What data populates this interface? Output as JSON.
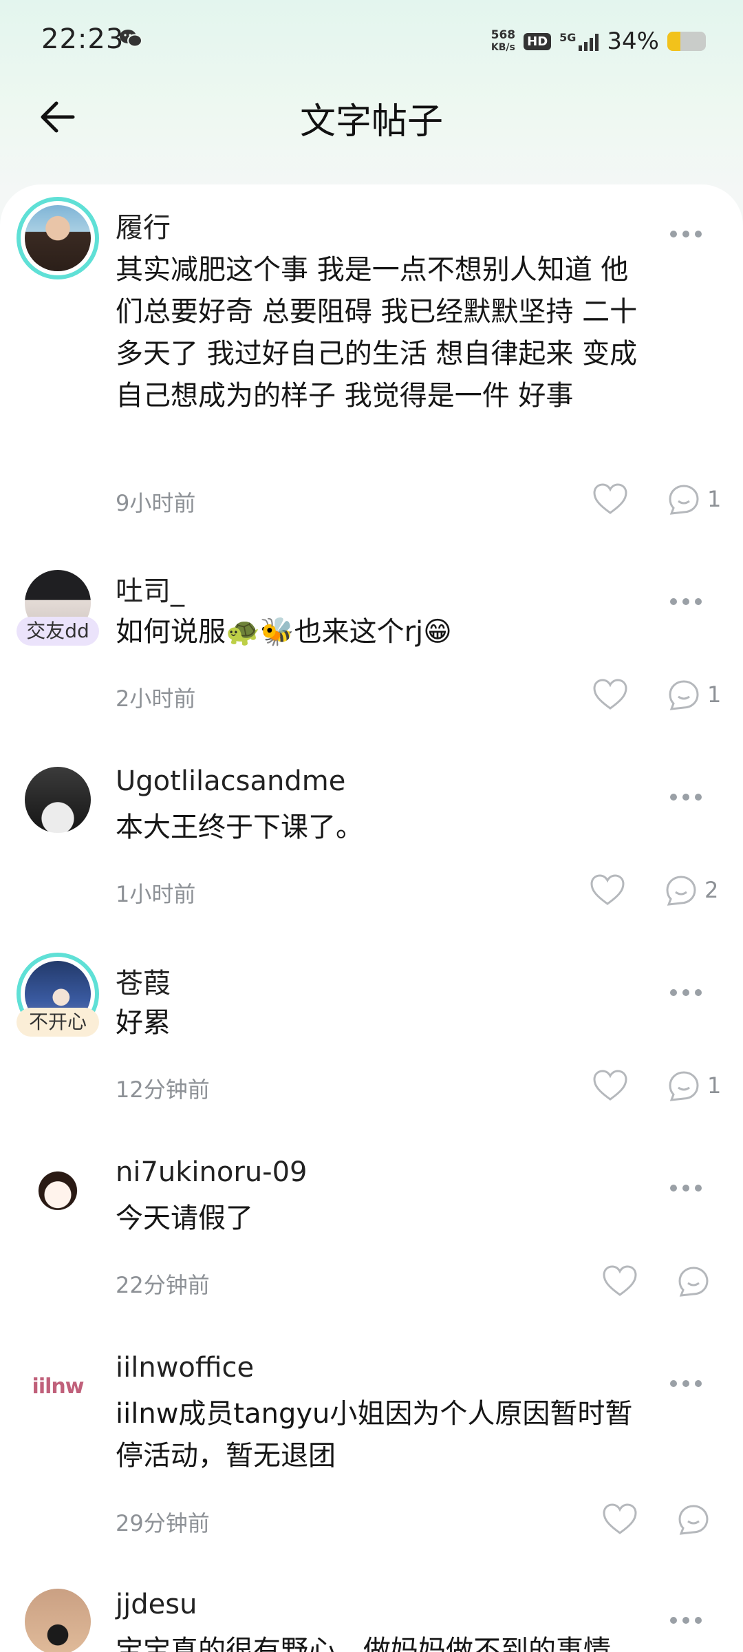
{
  "status_bar": {
    "time": "22:23",
    "net_speed_value": "568",
    "net_speed_unit": "KB/s",
    "hd": "HD",
    "network": "5G",
    "battery_text": "34%",
    "battery_level": 0.34,
    "icons": [
      "wechat-icon",
      "signal-icon",
      "battery-icon"
    ]
  },
  "header": {
    "title": "文字帖子",
    "back_icon": "arrow-left-icon"
  },
  "posts": [
    {
      "username": "履行",
      "content": "其实减肥这个事 我是一点不想别人知道 他们总要好奇 总要阻碍 我已经默默坚持 二十多天了 我过好自己的生活 想自律起来 变成自己想成为的样子 我觉得是一件 好事",
      "time": "9小时前",
      "comments": "1",
      "badge": ""
    },
    {
      "username": "吐司_",
      "content": "如何说服🐢🐝也来这个rj😁",
      "time": "2小时前",
      "comments": "1",
      "badge": "交友dd"
    },
    {
      "username": "Ugotlilacsandme",
      "content": "本大王终于下课了。",
      "time": "1小时前",
      "comments": "2",
      "badge": ""
    },
    {
      "username": "苍葭",
      "content": "好累",
      "time": "12分钟前",
      "comments": "1",
      "badge": "不开心"
    },
    {
      "username": "ni7ukinoru-09",
      "content": "今天请假了",
      "time": "22分钟前",
      "comments": "",
      "badge": ""
    },
    {
      "username": "iilnwoffice",
      "content": "iilnw成员tangyu小姐因为个人原因暂时暂停活动，暂无退团",
      "time": "29分钟前",
      "comments": "",
      "badge": "",
      "avatar_logo": "iilnw"
    },
    {
      "username": "jjdesu",
      "content": "宝宝真的很有野心，做妈妈做不到的事情",
      "time": "",
      "comments": "",
      "badge": ""
    }
  ]
}
